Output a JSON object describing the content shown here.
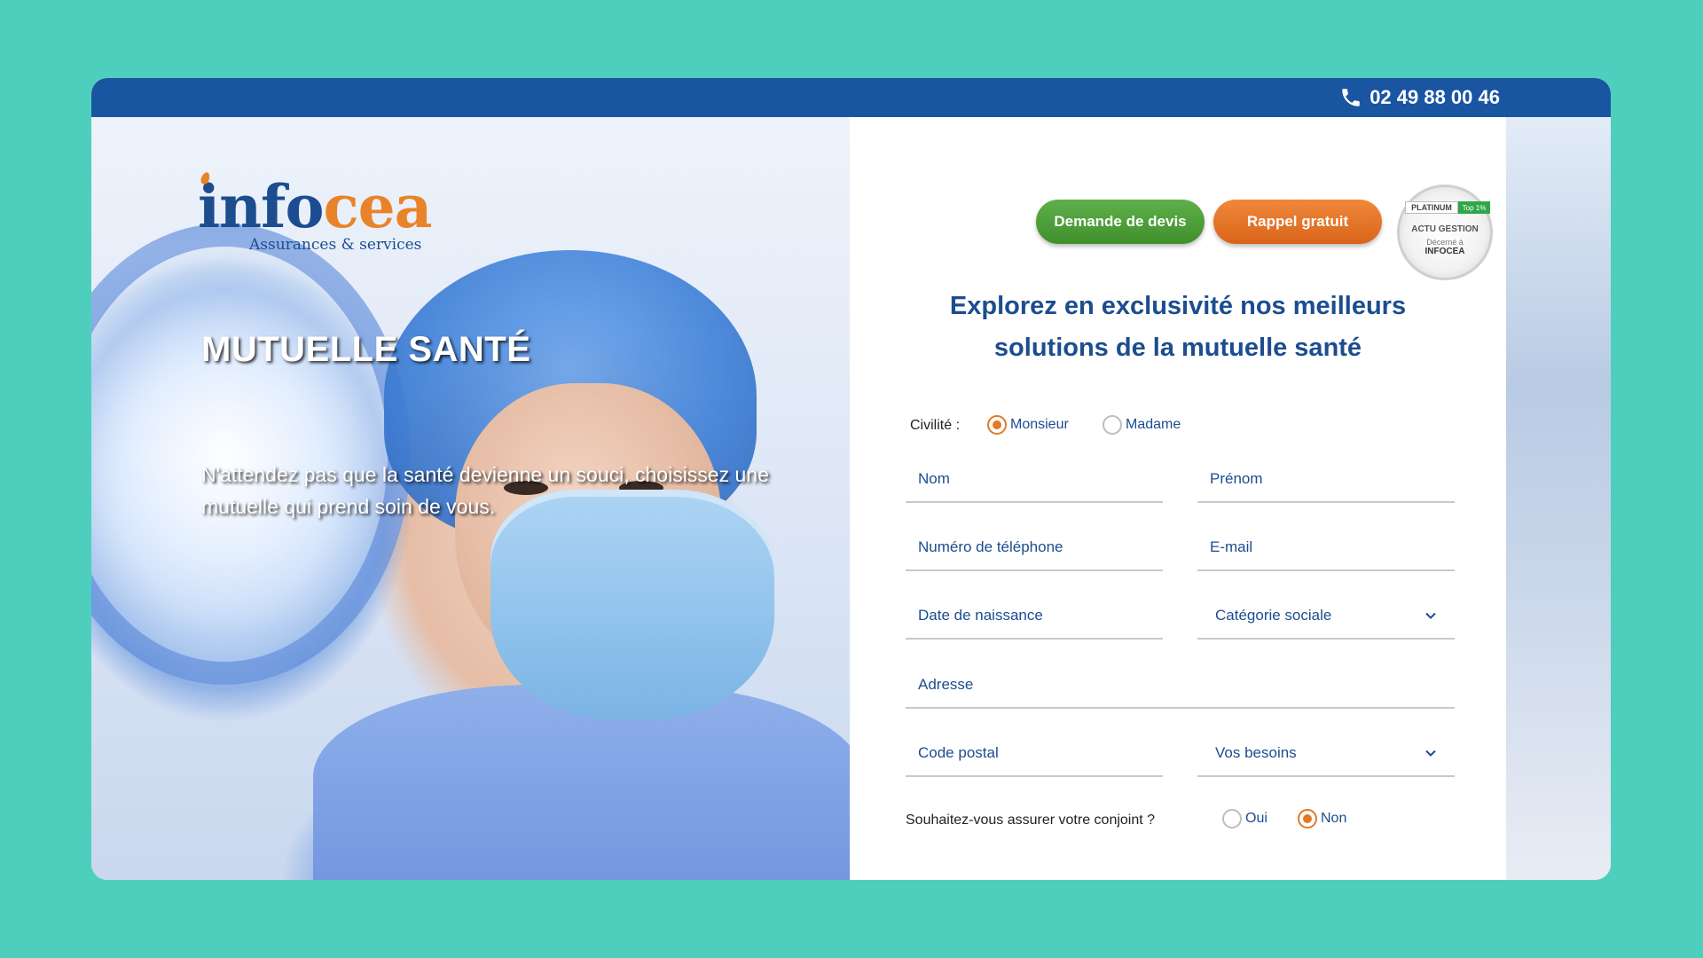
{
  "topbar": {
    "phone": "02 49 88 00 46"
  },
  "logo": {
    "word_a": "info",
    "word_b": "cea",
    "tagline": "Assurances & services"
  },
  "hero": {
    "title": "MUTUELLE SANTÉ",
    "subtitle": "N'attendez pas que la santé devienne un souci, choisissez une mutuelle qui prend soin de vous."
  },
  "actions": {
    "quote_button": "Demande de devis",
    "callback_button": "Rappel gratuit"
  },
  "badge": {
    "ribbon": "PLATINUM",
    "ribbon_tag": "Top 1%",
    "line1": "ACTU GESTION",
    "line2": "Décerné à",
    "line3": "INFOCEA"
  },
  "form": {
    "title": "Explorez en exclusivité nos meilleurs solutions de la mutuelle santé",
    "civility": {
      "label": "Civilité :",
      "options": [
        "Monsieur",
        "Madame"
      ],
      "selected": "Monsieur"
    },
    "fields": {
      "nom": "Nom",
      "prenom": "Prénom",
      "telephone": "Numéro de téléphone",
      "email": "E-mail",
      "naissance": "Date de naissance",
      "categorie": "Catégorie sociale",
      "adresse": "Adresse",
      "code_postal": "Code postal",
      "besoins": "Vos besoins"
    },
    "spouse": {
      "label": "Souhaitez-vous assurer votre conjoint ?",
      "options": [
        "Oui",
        "Non"
      ],
      "selected": "Non"
    }
  },
  "colors": {
    "brand_blue": "#1b4d8f",
    "topbar": "#1a55a2",
    "accent_orange": "#e07a25",
    "green": "#4a9e36",
    "background": "#4ecfbe"
  }
}
